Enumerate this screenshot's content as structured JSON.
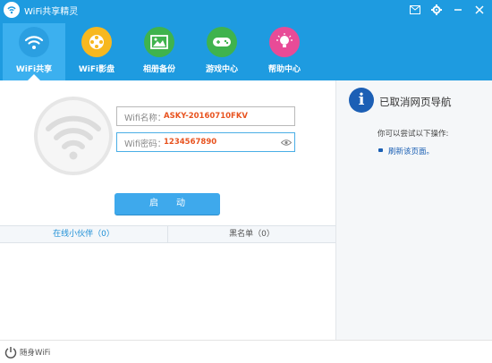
{
  "app": {
    "title": "WiFi共享精灵"
  },
  "nav": [
    {
      "label": "WiFi共享",
      "icon": "wifi-icon",
      "color": "#2b9fe1",
      "active": true
    },
    {
      "label": "WiFi影盘",
      "icon": "film-reel-icon",
      "color": "#f7b81f",
      "active": false
    },
    {
      "label": "相册备份",
      "icon": "photo-icon",
      "color": "#3fb34d",
      "active": false
    },
    {
      "label": "游戏中心",
      "icon": "gamepad-icon",
      "color": "#3fb34d",
      "active": false
    },
    {
      "label": "帮助中心",
      "icon": "lightbulb-icon",
      "color": "#e84b97",
      "active": false
    }
  ],
  "form": {
    "name_label": "Wifi名称：",
    "name_value": "ASKY-20160710FKV",
    "password_label": "Wifi密码：",
    "password_value": "1234567890",
    "start_label": "启　　动"
  },
  "tabs": {
    "online": "在线小伙伴（0）",
    "blacklist": "黑名单（0）"
  },
  "side": {
    "title": "已取消网页导航",
    "hint": "你可以尝试以下操作:",
    "link": "刷新该页面。"
  },
  "footer": {
    "label": "随身WiFi"
  }
}
